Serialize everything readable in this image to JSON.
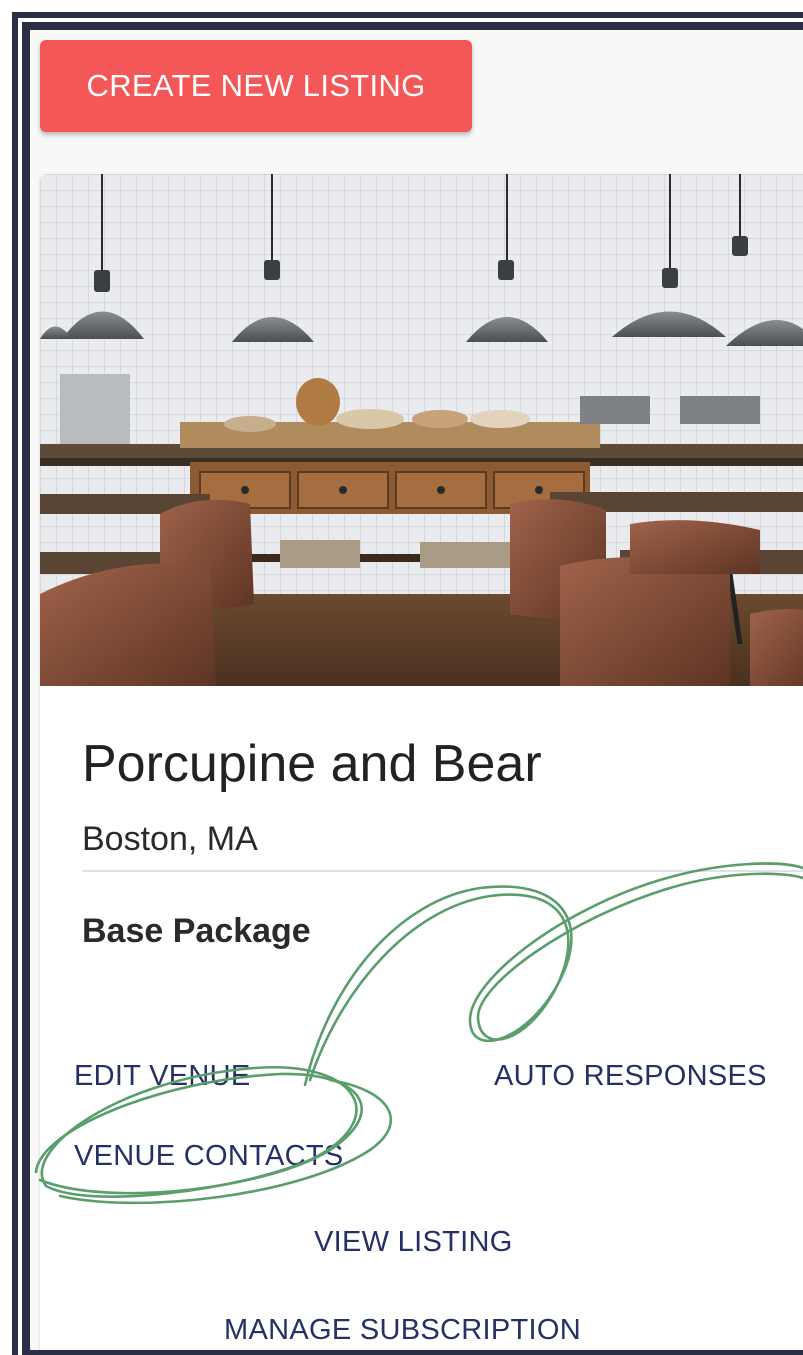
{
  "header": {
    "create_button_label": "CREATE NEW LISTING"
  },
  "listing": {
    "title": "Porcupine and Bear",
    "location": "Boston, MA",
    "package": "Base Package",
    "actions": {
      "edit_venue": "EDIT VENUE",
      "auto_responses": "AUTO RESPONSES",
      "venue_contacts": "VENUE CONTACTS",
      "view_listing": "VIEW LISTING",
      "manage_subscription": "MANAGE SUBSCRIPTION"
    }
  },
  "colors": {
    "accent": "#f45757",
    "link": "#253064",
    "frame": "#2b2f45",
    "annotation": "#5a9e6c"
  }
}
